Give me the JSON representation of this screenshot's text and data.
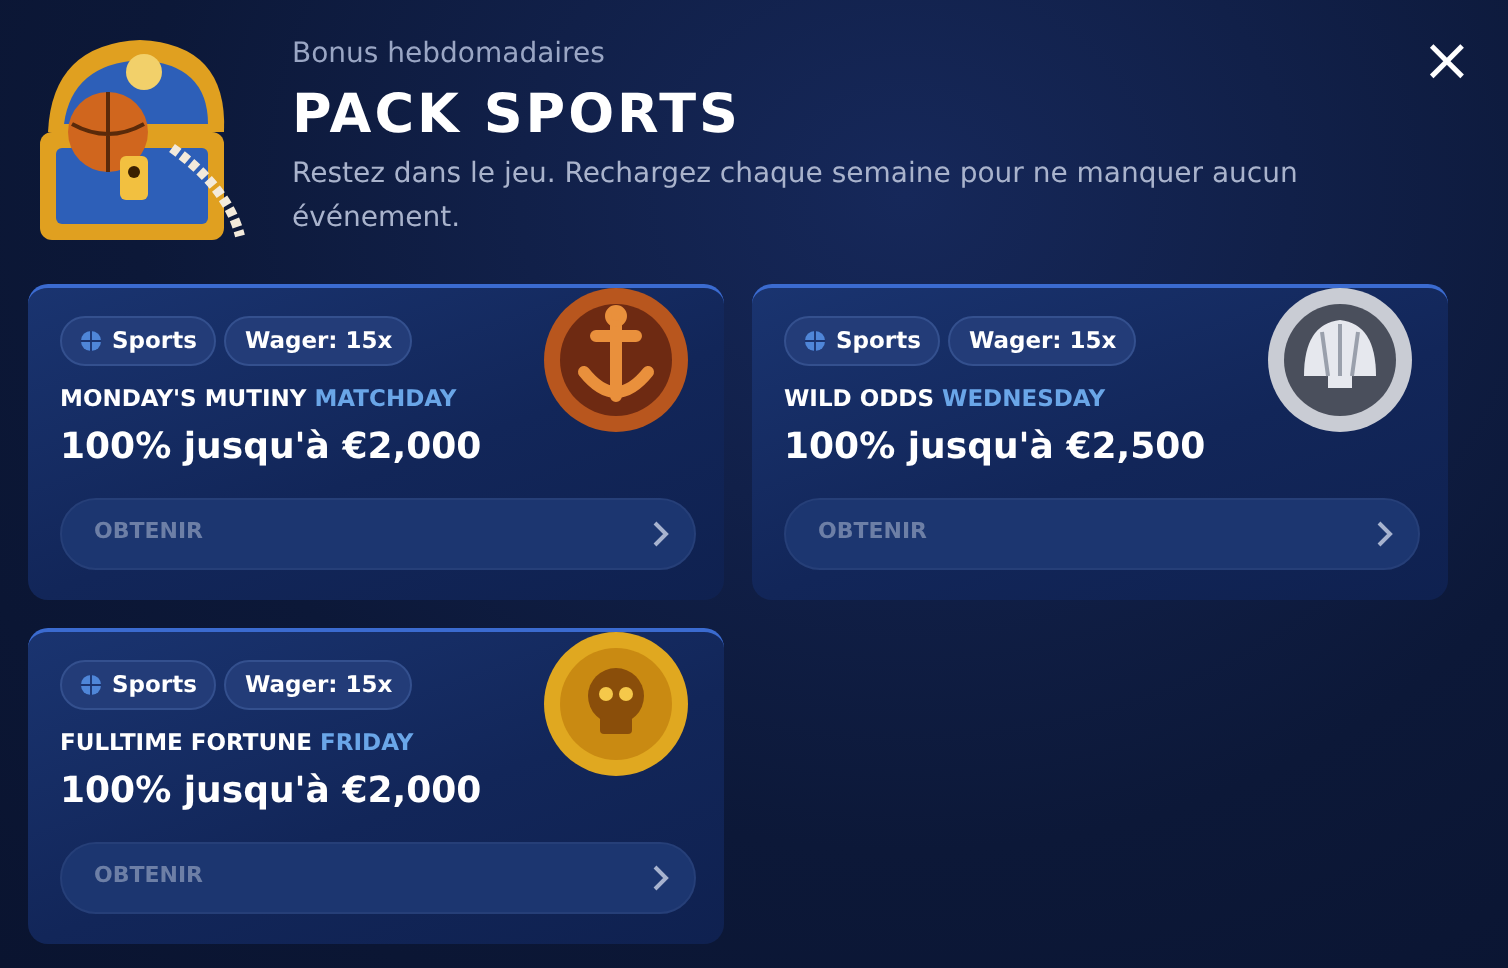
{
  "header": {
    "eyebrow": "Bonus hebdomadaires",
    "title": "PACK SPORTS",
    "description": "Restez dans le jeu. Rechargez chaque semaine pour ne manquer aucun événement.",
    "close": "×"
  },
  "offers": [
    {
      "tags": [
        "Sports",
        "Wager: 15x"
      ],
      "title_lead": "MONDAY'S MUTINY",
      "title_accent": "MATCHDAY",
      "amount": "100% jusqu'à €2,000",
      "button": "OBTENIR",
      "coin": {
        "kind": "anchor"
      }
    },
    {
      "tags": [
        "Sports",
        "Wager: 15x"
      ],
      "title_lead": "WILD ODDS",
      "title_accent": "WEDNESDAY",
      "amount": "100% jusqu'à €2,500",
      "button": "OBTENIR",
      "coin": {
        "kind": "shell"
      }
    },
    {
      "tags": [
        "Sports",
        "Wager: 15x"
      ],
      "title_lead": "FULLTIME FORTUNE",
      "title_accent": "FRIDAY",
      "amount": "100% jusqu'à €2,000",
      "button": "OBTENIR",
      "coin": {
        "kind": "skull"
      }
    }
  ]
}
